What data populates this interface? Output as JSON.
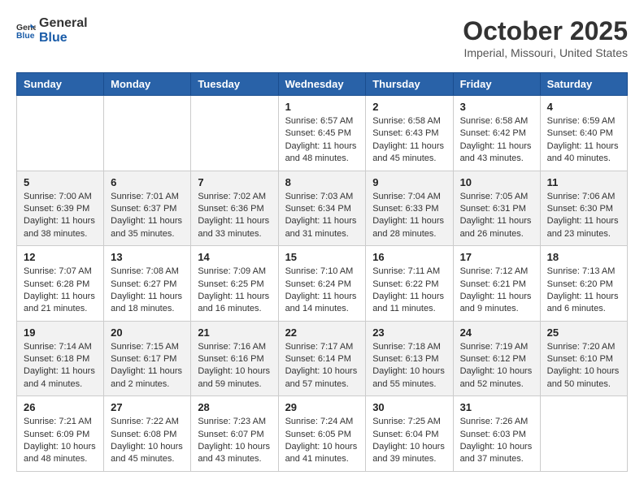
{
  "header": {
    "logo": {
      "text_general": "General",
      "text_blue": "Blue"
    },
    "title": "October 2025",
    "location": "Imperial, Missouri, United States"
  },
  "weekdays": [
    "Sunday",
    "Monday",
    "Tuesday",
    "Wednesday",
    "Thursday",
    "Friday",
    "Saturday"
  ],
  "weeks": [
    [
      null,
      null,
      null,
      {
        "day": "1",
        "sunrise": "6:57 AM",
        "sunset": "6:45 PM",
        "daylight": "11 hours and 48 minutes."
      },
      {
        "day": "2",
        "sunrise": "6:58 AM",
        "sunset": "6:43 PM",
        "daylight": "11 hours and 45 minutes."
      },
      {
        "day": "3",
        "sunrise": "6:58 AM",
        "sunset": "6:42 PM",
        "daylight": "11 hours and 43 minutes."
      },
      {
        "day": "4",
        "sunrise": "6:59 AM",
        "sunset": "6:40 PM",
        "daylight": "11 hours and 40 minutes."
      }
    ],
    [
      {
        "day": "5",
        "sunrise": "7:00 AM",
        "sunset": "6:39 PM",
        "daylight": "11 hours and 38 minutes."
      },
      {
        "day": "6",
        "sunrise": "7:01 AM",
        "sunset": "6:37 PM",
        "daylight": "11 hours and 35 minutes."
      },
      {
        "day": "7",
        "sunrise": "7:02 AM",
        "sunset": "6:36 PM",
        "daylight": "11 hours and 33 minutes."
      },
      {
        "day": "8",
        "sunrise": "7:03 AM",
        "sunset": "6:34 PM",
        "daylight": "11 hours and 31 minutes."
      },
      {
        "day": "9",
        "sunrise": "7:04 AM",
        "sunset": "6:33 PM",
        "daylight": "11 hours and 28 minutes."
      },
      {
        "day": "10",
        "sunrise": "7:05 AM",
        "sunset": "6:31 PM",
        "daylight": "11 hours and 26 minutes."
      },
      {
        "day": "11",
        "sunrise": "7:06 AM",
        "sunset": "6:30 PM",
        "daylight": "11 hours and 23 minutes."
      }
    ],
    [
      {
        "day": "12",
        "sunrise": "7:07 AM",
        "sunset": "6:28 PM",
        "daylight": "11 hours and 21 minutes."
      },
      {
        "day": "13",
        "sunrise": "7:08 AM",
        "sunset": "6:27 PM",
        "daylight": "11 hours and 18 minutes."
      },
      {
        "day": "14",
        "sunrise": "7:09 AM",
        "sunset": "6:25 PM",
        "daylight": "11 hours and 16 minutes."
      },
      {
        "day": "15",
        "sunrise": "7:10 AM",
        "sunset": "6:24 PM",
        "daylight": "11 hours and 14 minutes."
      },
      {
        "day": "16",
        "sunrise": "7:11 AM",
        "sunset": "6:22 PM",
        "daylight": "11 hours and 11 minutes."
      },
      {
        "day": "17",
        "sunrise": "7:12 AM",
        "sunset": "6:21 PM",
        "daylight": "11 hours and 9 minutes."
      },
      {
        "day": "18",
        "sunrise": "7:13 AM",
        "sunset": "6:20 PM",
        "daylight": "11 hours and 6 minutes."
      }
    ],
    [
      {
        "day": "19",
        "sunrise": "7:14 AM",
        "sunset": "6:18 PM",
        "daylight": "11 hours and 4 minutes."
      },
      {
        "day": "20",
        "sunrise": "7:15 AM",
        "sunset": "6:17 PM",
        "daylight": "11 hours and 2 minutes."
      },
      {
        "day": "21",
        "sunrise": "7:16 AM",
        "sunset": "6:16 PM",
        "daylight": "10 hours and 59 minutes."
      },
      {
        "day": "22",
        "sunrise": "7:17 AM",
        "sunset": "6:14 PM",
        "daylight": "10 hours and 57 minutes."
      },
      {
        "day": "23",
        "sunrise": "7:18 AM",
        "sunset": "6:13 PM",
        "daylight": "10 hours and 55 minutes."
      },
      {
        "day": "24",
        "sunrise": "7:19 AM",
        "sunset": "6:12 PM",
        "daylight": "10 hours and 52 minutes."
      },
      {
        "day": "25",
        "sunrise": "7:20 AM",
        "sunset": "6:10 PM",
        "daylight": "10 hours and 50 minutes."
      }
    ],
    [
      {
        "day": "26",
        "sunrise": "7:21 AM",
        "sunset": "6:09 PM",
        "daylight": "10 hours and 48 minutes."
      },
      {
        "day": "27",
        "sunrise": "7:22 AM",
        "sunset": "6:08 PM",
        "daylight": "10 hours and 45 minutes."
      },
      {
        "day": "28",
        "sunrise": "7:23 AM",
        "sunset": "6:07 PM",
        "daylight": "10 hours and 43 minutes."
      },
      {
        "day": "29",
        "sunrise": "7:24 AM",
        "sunset": "6:05 PM",
        "daylight": "10 hours and 41 minutes."
      },
      {
        "day": "30",
        "sunrise": "7:25 AM",
        "sunset": "6:04 PM",
        "daylight": "10 hours and 39 minutes."
      },
      {
        "day": "31",
        "sunrise": "7:26 AM",
        "sunset": "6:03 PM",
        "daylight": "10 hours and 37 minutes."
      },
      null
    ]
  ],
  "labels": {
    "sunrise": "Sunrise:",
    "sunset": "Sunset:",
    "daylight": "Daylight:"
  }
}
